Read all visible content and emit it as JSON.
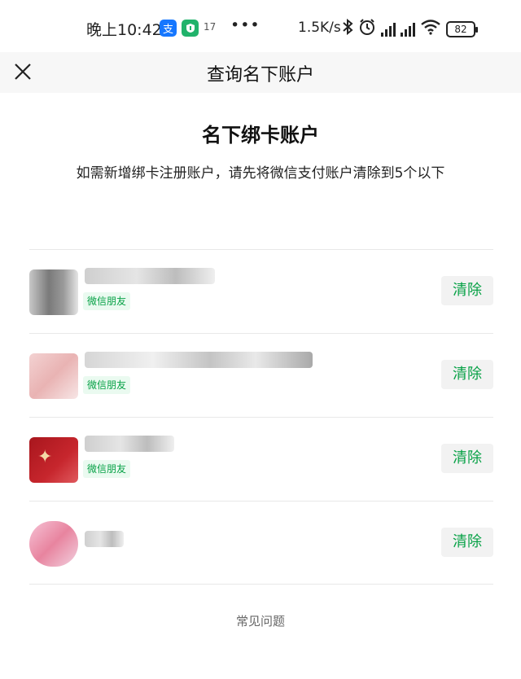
{
  "status_bar": {
    "time": "晚上10:42",
    "alipay_glyph": "支",
    "calendar": "17",
    "dots": "•••",
    "net_speed": "1.5K/s",
    "battery": "82",
    "icons": [
      "alipay-icon",
      "shield-icon",
      "calendar-icon",
      "bluetooth-icon",
      "alarm-icon",
      "signal-icon",
      "wifi-icon",
      "battery-icon"
    ]
  },
  "nav": {
    "title": "查询名下账户",
    "close_icon": "close-icon"
  },
  "section": {
    "title": "名下绑卡账户",
    "description": "如需新增绑卡注册账户，请先将微信支付账户清除到5个以下"
  },
  "accounts": [
    {
      "tag": "微信朋友",
      "action": "清除"
    },
    {
      "tag": "微信朋友",
      "action": "清除"
    },
    {
      "tag": "微信朋友",
      "action": "清除"
    },
    {
      "tag": "",
      "action": "清除"
    }
  ],
  "footer": {
    "faq": "常见问题"
  },
  "colors": {
    "accent_green": "#07a146",
    "tag_background": "#eafaf0",
    "nav_background": "#f7f7f7"
  }
}
